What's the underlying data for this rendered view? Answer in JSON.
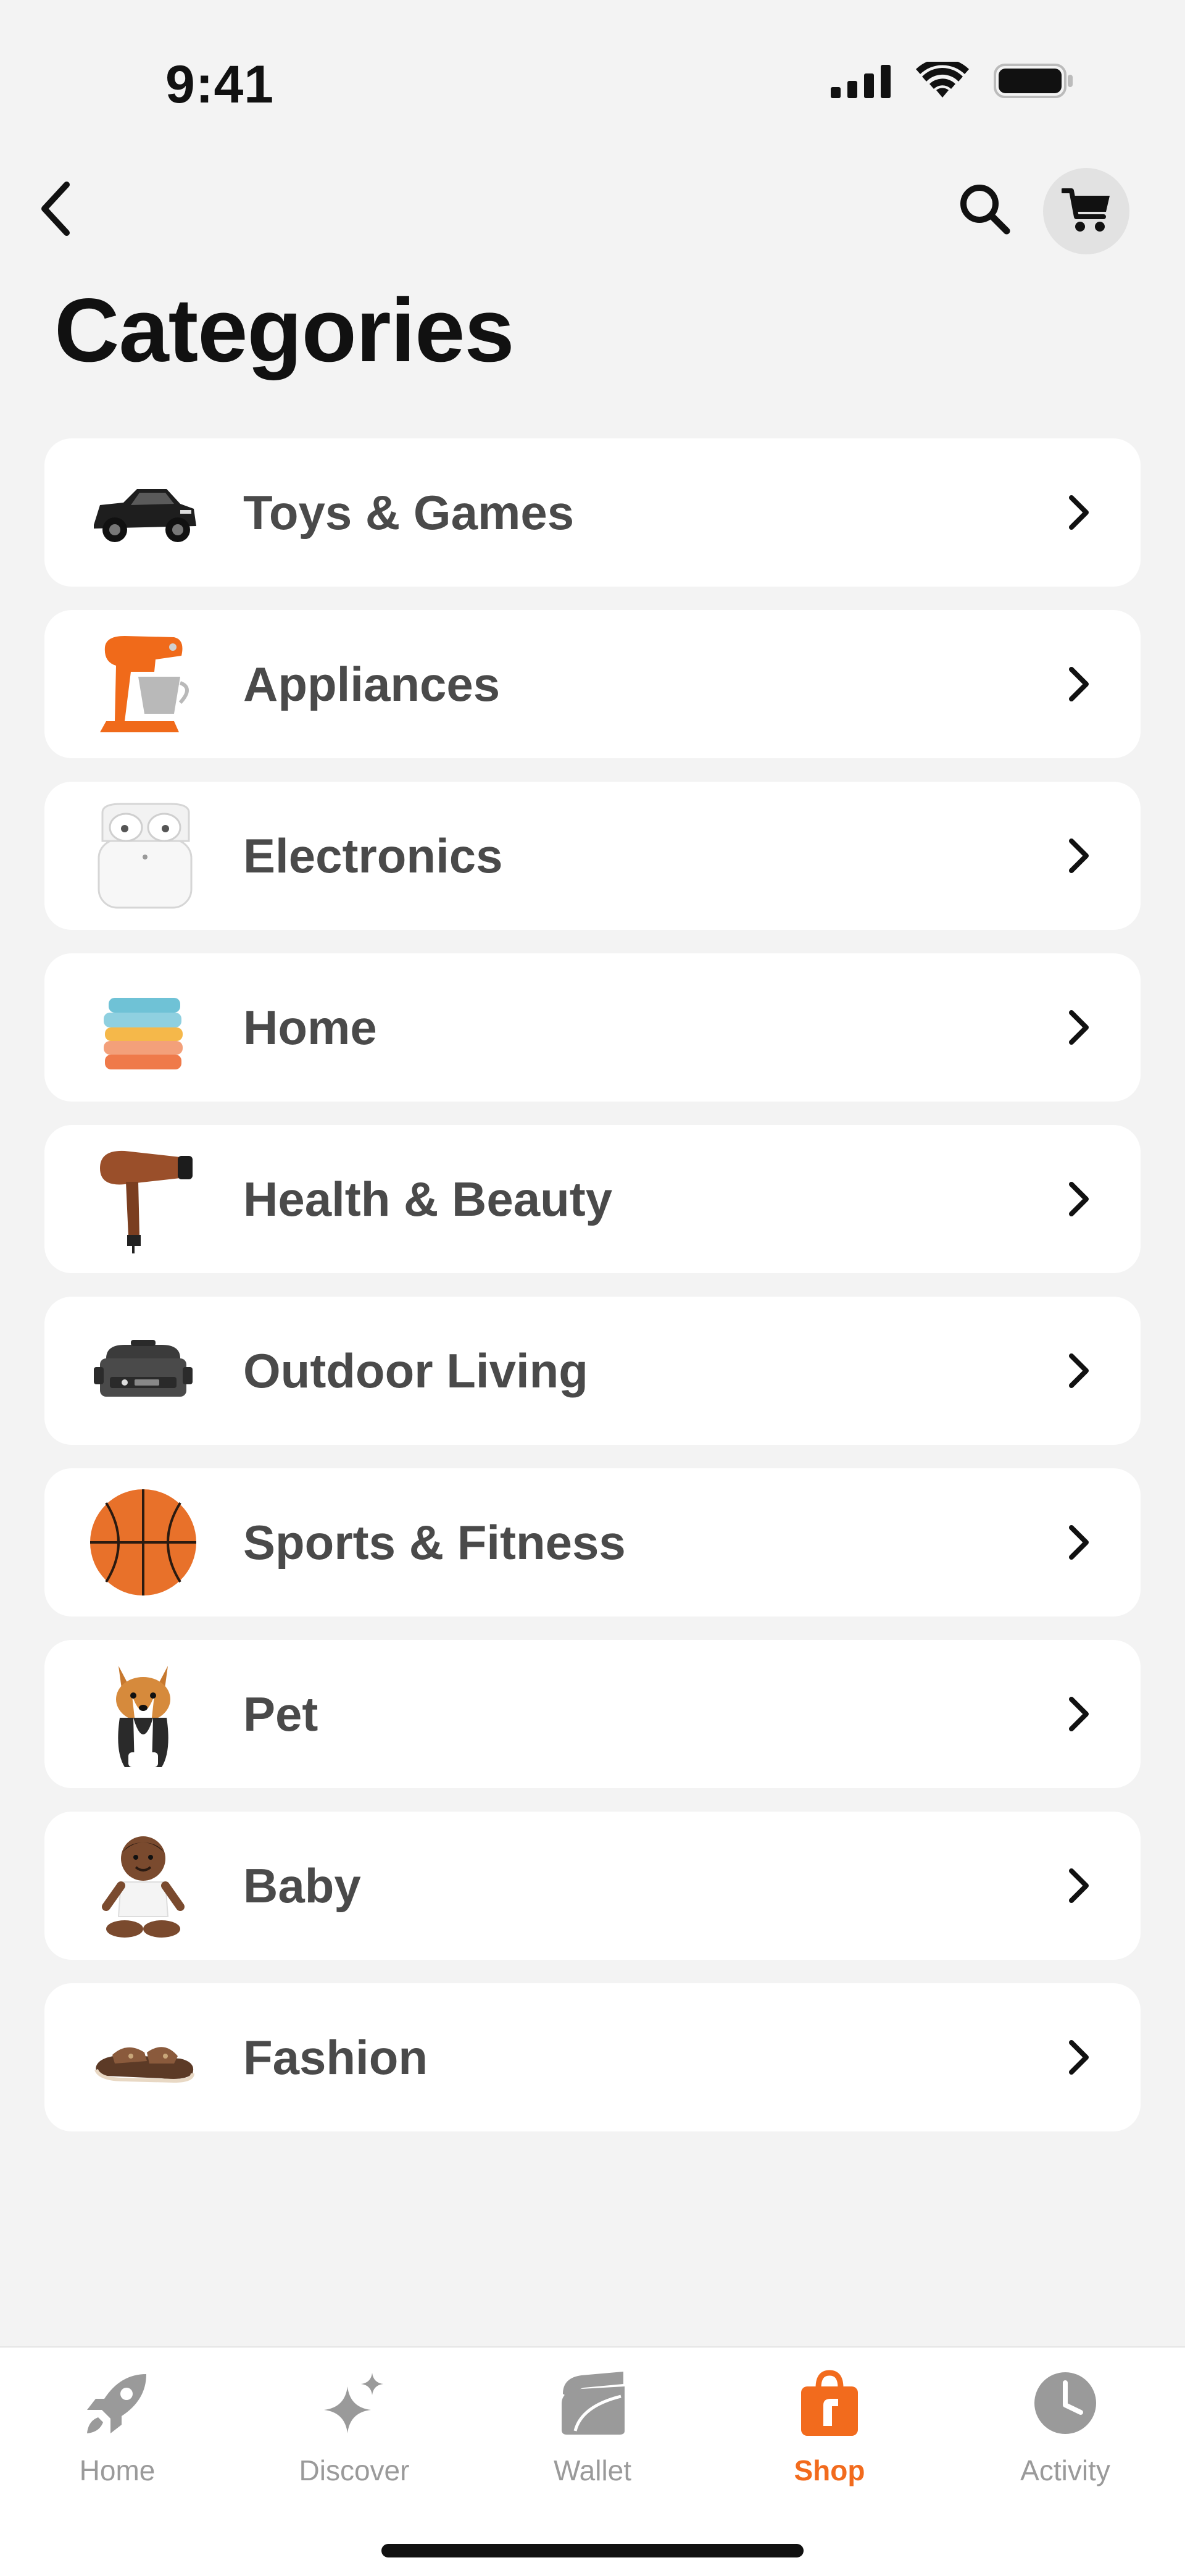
{
  "status_bar": {
    "time": "9:41"
  },
  "nav": {
    "back_icon": "chevron-left-icon",
    "search_icon": "search-icon",
    "cart_icon": "cart-icon"
  },
  "page": {
    "title": "Categories"
  },
  "categories": [
    {
      "label": "Toys & Games",
      "thumb": "toy-car"
    },
    {
      "label": "Appliances",
      "thumb": "stand-mixer"
    },
    {
      "label": "Electronics",
      "thumb": "earbuds-case"
    },
    {
      "label": "Home",
      "thumb": "towels"
    },
    {
      "label": "Health & Beauty",
      "thumb": "hair-dryer"
    },
    {
      "label": "Outdoor Living",
      "thumb": "grill"
    },
    {
      "label": "Sports & Fitness",
      "thumb": "basketball"
    },
    {
      "label": "Pet",
      "thumb": "corgi"
    },
    {
      "label": "Baby",
      "thumb": "baby"
    },
    {
      "label": "Fashion",
      "thumb": "sandal"
    }
  ],
  "tab_bar": {
    "tabs": [
      {
        "label": "Home",
        "icon": "rocket-icon",
        "active": false
      },
      {
        "label": "Discover",
        "icon": "sparkle-icon",
        "active": false
      },
      {
        "label": "Wallet",
        "icon": "wallet-icon",
        "active": false
      },
      {
        "label": "Shop",
        "icon": "shopping-bag-icon",
        "active": true
      },
      {
        "label": "Activity",
        "icon": "clock-icon",
        "active": false
      }
    ]
  },
  "colors": {
    "accent": "#f26b1d",
    "background": "#f3f3f3",
    "card": "#ffffff",
    "inactive_tab": "#9a9a9a"
  }
}
